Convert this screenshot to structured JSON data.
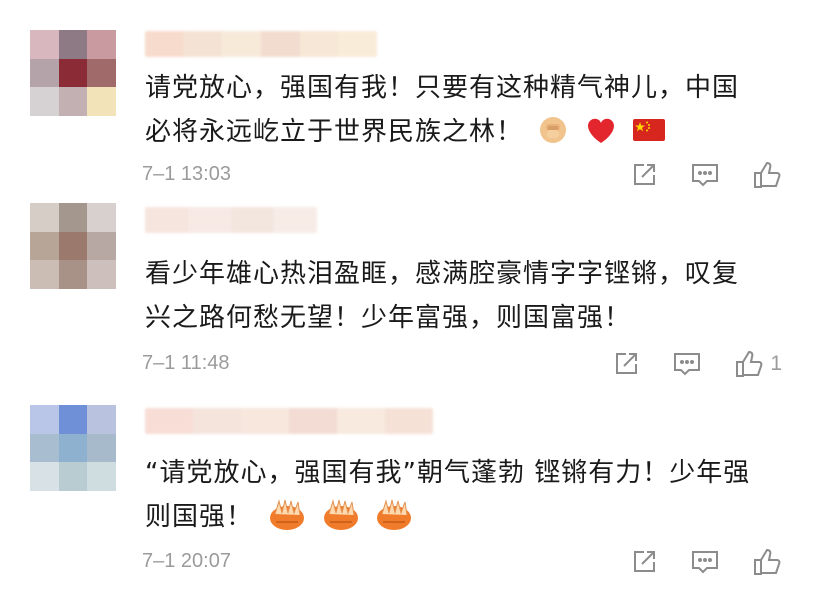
{
  "comments": [
    {
      "text_line1": "请党放心，强国有我！只要有这种精气神儿，中国",
      "text_line2": "必将永远屹立于世界民族之林！",
      "emojis": [
        "fist-emoji",
        "heart-emoji",
        "china-flag-emoji"
      ],
      "time": "7–1 13:03",
      "likes": "",
      "colors": {
        "avatar": [
          "#d9b7bf",
          "#8e7a84",
          "#c99aa0",
          "#b4a3a8",
          "#8b2b35",
          "#a06a6a",
          "#d6d2d4",
          "#c2b0b2",
          "#f3e3b8"
        ]
      }
    },
    {
      "text_line1": "看少年雄心热泪盈眶，感满腔豪情字字铿锵，叹复",
      "text_line2": "兴之路何愁无望！少年富强，则国富强！",
      "emojis": [],
      "time": "7–1 11:48",
      "likes": "1",
      "colors": {
        "avatar": [
          "#d7cdc7",
          "#a4978d",
          "#d8d0ce",
          "#b7a597",
          "#9b7a6d",
          "#b7a8a3",
          "#cbbdb3",
          "#a89186",
          "#cdbfbb"
        ]
      }
    },
    {
      "text_line1": "“请党放心，强国有我”朝气蓬勃 铿锵有力！少年强",
      "text_line2": "则国强！",
      "emojis": [
        "clap-hands-emoji",
        "clap-hands-emoji",
        "clap-hands-emoji"
      ],
      "time": "7–1 20:07",
      "likes": "",
      "colors": {
        "avatar": [
          "#b9c6e8",
          "#6f8fd6",
          "#b9c3e0",
          "#a8bdd0",
          "#8db1cf",
          "#a6bacb",
          "#d8e2e6",
          "#b9ccd2",
          "#cfdce0"
        ]
      }
    }
  ],
  "icons": {
    "share": "share-icon",
    "reply": "reply-comment-icon",
    "like": "thumbs-up-icon"
  }
}
